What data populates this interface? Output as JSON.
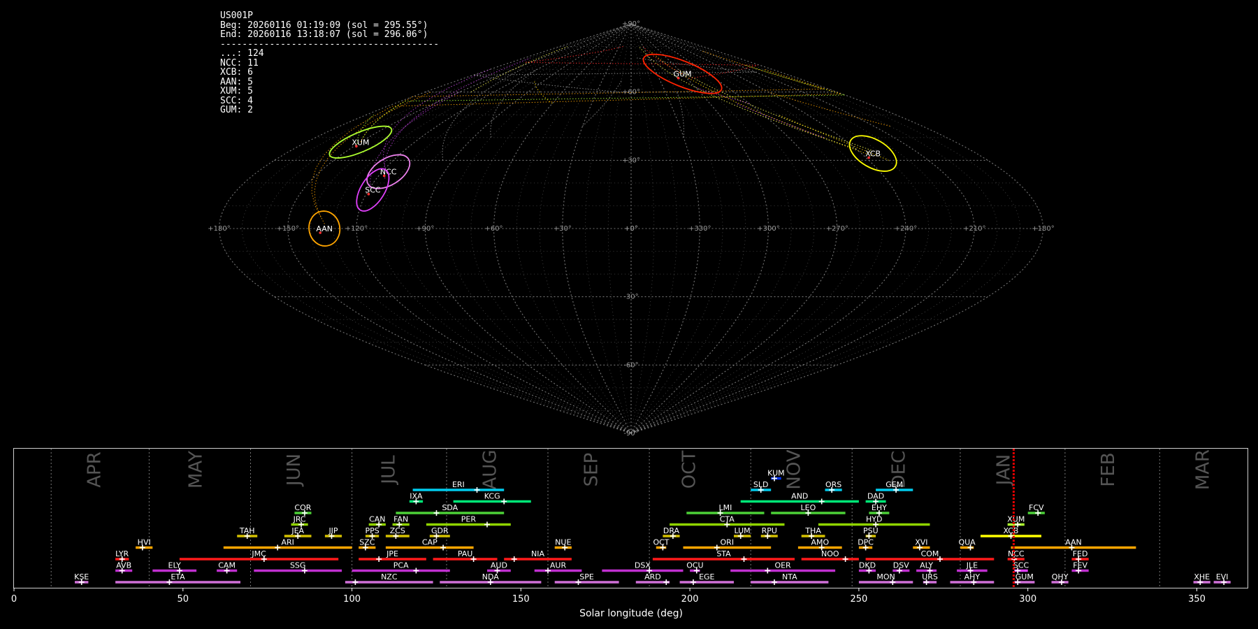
{
  "header": {
    "station": "US001P",
    "begin": "Beg: 20260116 01:19:09 (sol = 295.55°)",
    "end": "End: 20260116 13:18:07 (sol = 296.06°)",
    "separator": "----------------------------------------",
    "counts": [
      "...: 124",
      "NCC: 11",
      "XCB: 6",
      "AAN: 5",
      "XUM: 5",
      "SCC: 4",
      "GUM: 2"
    ]
  },
  "colors": {
    "background": "#000000",
    "grid": "#8a8a8a",
    "current_sol": "#e00000"
  },
  "chart_data": [
    {
      "type": "scatter",
      "projection": "sinusoidal",
      "ra_ticks": [
        "+180°",
        "+150°",
        "+120°",
        "+90°",
        "+60°",
        "+30°",
        "+0°",
        "+330°",
        "+300°",
        "+270°",
        "+240°",
        "+210°",
        "+180°"
      ],
      "dec_ticks": [
        "+90°",
        "+60°",
        "+30°",
        "+0°",
        "-30°",
        "-60°",
        "-90°"
      ],
      "radiants": [
        {
          "code": "XUM",
          "ra": 150,
          "dec": 38,
          "color": "#adff2f"
        },
        {
          "code": "NCC",
          "ra": 117,
          "dec": 25,
          "color": "#ee82ee"
        },
        {
          "code": "SCC",
          "ra": 118,
          "dec": 17,
          "color": "#e040fb"
        },
        {
          "code": "AAN",
          "ra": 134,
          "dec": 0,
          "color": "#ffa500"
        },
        {
          "code": "GUM",
          "ra": 300,
          "dec": 68,
          "color": "#ff2200"
        },
        {
          "code": "XCB",
          "ra": 234,
          "dec": 33,
          "color": "#ffff00"
        }
      ]
    },
    {
      "type": "bar",
      "xlabel": "Solar longitude (deg)",
      "xlim": [
        0,
        365
      ],
      "xticks": [
        0,
        50,
        100,
        150,
        200,
        250,
        300,
        350
      ],
      "current_sol": 295.8,
      "months": [
        {
          "label": "APR",
          "sol": 24
        },
        {
          "label": "MAY",
          "sol": 54
        },
        {
          "label": "JUN",
          "sol": 83
        },
        {
          "label": "JUL",
          "sol": 111
        },
        {
          "label": "AUG",
          "sol": 141
        },
        {
          "label": "SEP",
          "sol": 171
        },
        {
          "label": "OCT",
          "sol": 200
        },
        {
          "label": "NOV",
          "sol": 231
        },
        {
          "label": "DEC",
          "sol": 262
        },
        {
          "label": "JAN",
          "sol": 293
        },
        {
          "label": "FEB",
          "sol": 324
        },
        {
          "label": "MAR",
          "sol": 352
        }
      ],
      "month_boundaries": [
        11,
        40,
        70,
        100,
        128,
        158,
        188,
        218,
        248,
        280,
        311,
        339
      ],
      "showers": [
        {
          "code": "KUM",
          "start": 224,
          "end": 227,
          "peak": 225,
          "row": 9,
          "color": "#0033ff"
        },
        {
          "code": "ERI",
          "start": 118,
          "end": 145,
          "peak": 137,
          "row": 8,
          "color": "#00ccee"
        },
        {
          "code": "SLD",
          "start": 218,
          "end": 224,
          "peak": 221,
          "row": 8,
          "color": "#00ccee"
        },
        {
          "code": "ORS",
          "start": 240,
          "end": 245,
          "peak": 242,
          "row": 8,
          "color": "#00ccee"
        },
        {
          "code": "GEM",
          "start": 255,
          "end": 266,
          "peak": 261,
          "row": 8,
          "color": "#00ccee"
        },
        {
          "code": "IXA",
          "start": 117,
          "end": 121,
          "peak": 119,
          "row": 7,
          "color": "#00e676"
        },
        {
          "code": "KCG",
          "start": 130,
          "end": 153,
          "peak": 145,
          "row": 7,
          "color": "#00e676"
        },
        {
          "code": "AND",
          "start": 215,
          "end": 250,
          "peak": 239,
          "row": 7,
          "color": "#00e676"
        },
        {
          "code": "DAD",
          "start": 252,
          "end": 258,
          "peak": 255,
          "row": 7,
          "color": "#00e676"
        },
        {
          "code": "COR",
          "start": 83,
          "end": 88,
          "peak": 86,
          "row": 6,
          "color": "#4cd137"
        },
        {
          "code": "SDA",
          "start": 113,
          "end": 145,
          "peak": 125,
          "row": 6,
          "color": "#4cd137"
        },
        {
          "code": "LMI",
          "start": 199,
          "end": 222,
          "peak": 209,
          "row": 6,
          "color": "#4cd137"
        },
        {
          "code": "LEO",
          "start": 224,
          "end": 246,
          "peak": 235,
          "row": 6,
          "color": "#4cd137"
        },
        {
          "code": "EHY",
          "start": 253,
          "end": 259,
          "peak": 256,
          "row": 6,
          "color": "#4cd137"
        },
        {
          "code": "FCV",
          "start": 300,
          "end": 305,
          "peak": 303,
          "row": 6,
          "color": "#4cd137"
        },
        {
          "code": "JRC",
          "start": 82,
          "end": 87,
          "peak": 85,
          "row": 5,
          "color": "#8fd400"
        },
        {
          "code": "CAN",
          "start": 105,
          "end": 110,
          "peak": 108,
          "row": 5,
          "color": "#8fd400"
        },
        {
          "code": "FAN",
          "start": 112,
          "end": 117,
          "peak": 114,
          "row": 5,
          "color": "#8fd400"
        },
        {
          "code": "PER",
          "start": 122,
          "end": 147,
          "peak": 140,
          "row": 5,
          "color": "#8fd400"
        },
        {
          "code": "CTA",
          "start": 194,
          "end": 228,
          "peak": 211,
          "row": 5,
          "color": "#8fd400"
        },
        {
          "code": "HYD",
          "start": 238,
          "end": 271,
          "peak": 255,
          "row": 5,
          "color": "#8fd400"
        },
        {
          "code": "XUM",
          "start": 294,
          "end": 299,
          "peak": 297,
          "row": 5,
          "color": "#adff2f"
        },
        {
          "code": "TAH",
          "start": 66,
          "end": 72,
          "peak": 69,
          "row": 4,
          "color": "#d4c000"
        },
        {
          "code": "JEA",
          "start": 80,
          "end": 88,
          "peak": 84,
          "row": 4,
          "color": "#d4c000"
        },
        {
          "code": "JIP",
          "start": 92,
          "end": 97,
          "peak": 94,
          "row": 4,
          "color": "#d4c000"
        },
        {
          "code": "PPS",
          "start": 104,
          "end": 108,
          "peak": 106,
          "row": 4,
          "color": "#d4c000"
        },
        {
          "code": "ZCS",
          "start": 110,
          "end": 117,
          "peak": 113,
          "row": 4,
          "color": "#d4c000"
        },
        {
          "code": "GDR",
          "start": 123,
          "end": 129,
          "peak": 125,
          "row": 4,
          "color": "#d4c000"
        },
        {
          "code": "DRA",
          "start": 192,
          "end": 197,
          "peak": 195,
          "row": 4,
          "color": "#d4c000"
        },
        {
          "code": "LUM",
          "start": 213,
          "end": 218,
          "peak": 215,
          "row": 4,
          "color": "#d4c000"
        },
        {
          "code": "RPU",
          "start": 221,
          "end": 226,
          "peak": 223,
          "row": 4,
          "color": "#d4c000"
        },
        {
          "code": "THA",
          "start": 233,
          "end": 240,
          "peak": 236,
          "row": 4,
          "color": "#d4c000"
        },
        {
          "code": "PSU",
          "start": 252,
          "end": 255,
          "peak": 253,
          "row": 4,
          "color": "#d4c000"
        },
        {
          "code": "XCB",
          "start": 286,
          "end": 304,
          "peak": 295,
          "row": 4,
          "color": "#ffff00"
        },
        {
          "code": "HVI",
          "start": 36,
          "end": 41,
          "peak": 38,
          "row": 3,
          "color": "#ffa500"
        },
        {
          "code": "ARI",
          "start": 62,
          "end": 100,
          "peak": 78,
          "row": 3,
          "color": "#ffa500"
        },
        {
          "code": "SZC",
          "start": 102,
          "end": 107,
          "peak": 104,
          "row": 3,
          "color": "#ffa500"
        },
        {
          "code": "CAP",
          "start": 110,
          "end": 136,
          "peak": 127,
          "row": 3,
          "color": "#ffa500"
        },
        {
          "code": "NUE",
          "start": 160,
          "end": 165,
          "peak": 163,
          "row": 3,
          "color": "#ffa500"
        },
        {
          "code": "OCT",
          "start": 190,
          "end": 193,
          "peak": 192,
          "row": 3,
          "color": "#ffa500"
        },
        {
          "code": "ORI",
          "start": 198,
          "end": 224,
          "peak": 208,
          "row": 3,
          "color": "#ffa500"
        },
        {
          "code": "AMO",
          "start": 232,
          "end": 245,
          "peak": 239,
          "row": 3,
          "color": "#ffa500"
        },
        {
          "code": "DPC",
          "start": 250,
          "end": 254,
          "peak": 252,
          "row": 3,
          "color": "#ffa500"
        },
        {
          "code": "XVI",
          "start": 266,
          "end": 271,
          "peak": 268,
          "row": 3,
          "color": "#ffa500"
        },
        {
          "code": "QUA",
          "start": 280,
          "end": 284,
          "peak": 283,
          "row": 3,
          "color": "#ffa500"
        },
        {
          "code": "AAN",
          "start": 295,
          "end": 332,
          "peak": 313,
          "row": 3,
          "color": "#ffa500"
        },
        {
          "code": "LYR",
          "start": 30,
          "end": 34,
          "peak": 32,
          "row": 2,
          "color": "#ff1a1a"
        },
        {
          "code": "JMC",
          "start": 49,
          "end": 96,
          "peak": 74,
          "row": 2,
          "color": "#ff1a1a"
        },
        {
          "code": "JPE",
          "start": 102,
          "end": 122,
          "peak": 108,
          "row": 2,
          "color": "#ff1a1a"
        },
        {
          "code": "PAU",
          "start": 124,
          "end": 143,
          "peak": 136,
          "row": 2,
          "color": "#ff1a1a"
        },
        {
          "code": "NIA",
          "start": 145,
          "end": 165,
          "peak": 148,
          "row": 2,
          "color": "#ff1a1a"
        },
        {
          "code": "STA",
          "start": 189,
          "end": 231,
          "peak": 216,
          "row": 2,
          "color": "#ff1a1a"
        },
        {
          "code": "NOO",
          "start": 233,
          "end": 250,
          "peak": 246,
          "row": 2,
          "color": "#ff1a1a"
        },
        {
          "code": "COM",
          "start": 252,
          "end": 290,
          "peak": 274,
          "row": 2,
          "color": "#ff1a1a"
        },
        {
          "code": "NCC",
          "start": 294,
          "end": 299,
          "peak": 296,
          "row": 2,
          "color": "#ff1a1a"
        },
        {
          "code": "FED",
          "start": 313,
          "end": 318,
          "peak": 315,
          "row": 2,
          "color": "#ff1a1a"
        },
        {
          "code": "AVB",
          "start": 30,
          "end": 35,
          "peak": 32,
          "row": 1,
          "color": "#c030d0"
        },
        {
          "code": "ELY",
          "start": 41,
          "end": 54,
          "peak": 49,
          "row": 1,
          "color": "#c030d0"
        },
        {
          "code": "CAM",
          "start": 60,
          "end": 66,
          "peak": 63,
          "row": 1,
          "color": "#c030d0"
        },
        {
          "code": "SSG",
          "start": 71,
          "end": 97,
          "peak": 86,
          "row": 1,
          "color": "#c030d0"
        },
        {
          "code": "PCA",
          "start": 100,
          "end": 129,
          "peak": 119,
          "row": 1,
          "color": "#c030d0"
        },
        {
          "code": "AUD",
          "start": 140,
          "end": 147,
          "peak": 143,
          "row": 1,
          "color": "#c030d0"
        },
        {
          "code": "AUR",
          "start": 154,
          "end": 168,
          "peak": 158,
          "row": 1,
          "color": "#c030d0"
        },
        {
          "code": "DSX",
          "start": 174,
          "end": 198,
          "peak": 188,
          "row": 1,
          "color": "#c030d0"
        },
        {
          "code": "OCU",
          "start": 200,
          "end": 203,
          "peak": 202,
          "row": 1,
          "color": "#c030d0"
        },
        {
          "code": "OER",
          "start": 212,
          "end": 243,
          "peak": 223,
          "row": 1,
          "color": "#c030d0"
        },
        {
          "code": "DKD",
          "start": 250,
          "end": 255,
          "peak": 253,
          "row": 1,
          "color": "#c030d0"
        },
        {
          "code": "DSV",
          "start": 260,
          "end": 265,
          "peak": 262,
          "row": 1,
          "color": "#c030d0"
        },
        {
          "code": "ALY",
          "start": 267,
          "end": 273,
          "peak": 271,
          "row": 1,
          "color": "#c030d0"
        },
        {
          "code": "JLE",
          "start": 279,
          "end": 288,
          "peak": 283,
          "row": 1,
          "color": "#c030d0"
        },
        {
          "code": "SCC",
          "start": 296,
          "end": 300,
          "peak": 297,
          "row": 1,
          "color": "#e040fb"
        },
        {
          "code": "FEV",
          "start": 313,
          "end": 318,
          "peak": 315,
          "row": 1,
          "color": "#c030d0"
        },
        {
          "code": "KSE",
          "start": 18,
          "end": 22,
          "peak": 20,
          "row": 0,
          "color": "#d070d8"
        },
        {
          "code": "ETA",
          "start": 30,
          "end": 67,
          "peak": 46,
          "row": 0,
          "color": "#d070d8"
        },
        {
          "code": "NZC",
          "start": 98,
          "end": 124,
          "peak": 101,
          "row": 0,
          "color": "#d070d8"
        },
        {
          "code": "NDA",
          "start": 126,
          "end": 156,
          "peak": 141,
          "row": 0,
          "color": "#d070d8"
        },
        {
          "code": "SPE",
          "start": 160,
          "end": 179,
          "peak": 167,
          "row": 0,
          "color": "#d070d8"
        },
        {
          "code": "ARD",
          "start": 184,
          "end": 194,
          "peak": 193,
          "row": 0,
          "color": "#d070d8"
        },
        {
          "code": "EGE",
          "start": 197,
          "end": 213,
          "peak": 201,
          "row": 0,
          "color": "#d070d8"
        },
        {
          "code": "NTA",
          "start": 218,
          "end": 241,
          "peak": 225,
          "row": 0,
          "color": "#d070d8"
        },
        {
          "code": "MON",
          "start": 250,
          "end": 266,
          "peak": 260,
          "row": 0,
          "color": "#d070d8"
        },
        {
          "code": "URS",
          "start": 269,
          "end": 273,
          "peak": 270,
          "row": 0,
          "color": "#d070d8"
        },
        {
          "code": "AHY",
          "start": 277,
          "end": 290,
          "peak": 284,
          "row": 0,
          "color": "#d070d8"
        },
        {
          "code": "GUM",
          "start": 296,
          "end": 302,
          "peak": 297,
          "row": 0,
          "color": "#d070d8"
        },
        {
          "code": "QHY",
          "start": 307,
          "end": 312,
          "peak": 310,
          "row": 0,
          "color": "#d070d8"
        },
        {
          "code": "XHE",
          "start": 349,
          "end": 354,
          "peak": 351,
          "row": 0,
          "color": "#d070d8"
        },
        {
          "code": "EVI",
          "start": 355,
          "end": 360,
          "peak": 358,
          "row": 0,
          "color": "#d070d8"
        }
      ]
    }
  ]
}
